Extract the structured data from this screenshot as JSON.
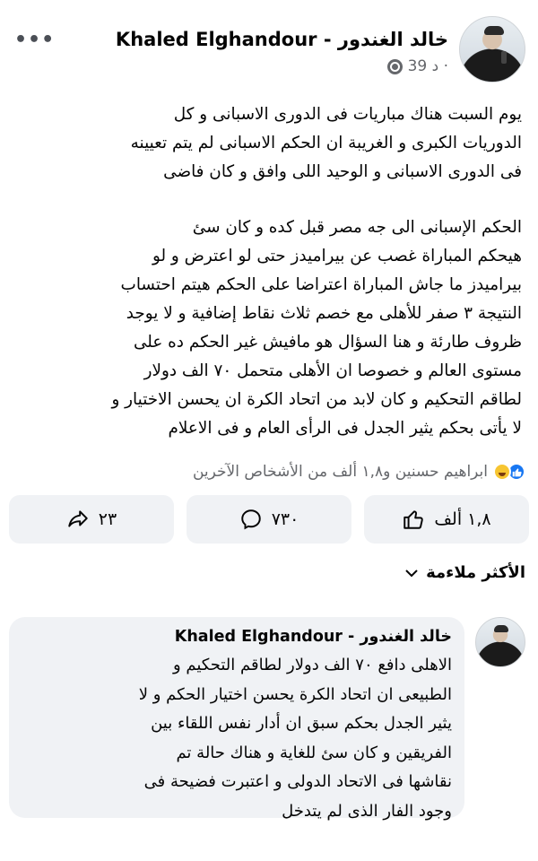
{
  "post": {
    "author": "Khaled Elghandour - خالد الغندور",
    "time": "39 د ·",
    "privacy_icon": "globe-icon",
    "more_label": "•••",
    "paragraph1": "يوم السبت هناك مباريات فى الدورى الاسبانى و كل\nالدوريات الكبرى  و الغريبة ان الحكم الاسبانى لم يتم تعيينه\nفى الدورى الاسبانى و الوحيد اللى وافق و كان فاضى",
    "paragraph2": "الحكم الإسبانى  الى جه مصر قبل كده و كان سئ\nهيحكم المباراة غصب عن بيراميدز حتى لو اعترض و لو\nبيراميدز ما جاش المباراة اعتراضا على الحكم هيتم احتساب\nالنتيجة ٣ صفر للأهلى مع خصم ثلاث نقاط إضافية و لا يوجد\nظروف طارئة  و هنا السؤال هو مافيش غير الحكم ده على\nمستوى العالم و خصوصا  ان الأهلى  متحمل ٧٠ الف دولار\nلطاقم التحكيم و كان لابد من اتحاد الكرة ان يحسن الاختيار و\nلا يأتى بحكم يثير الجدل فى الرأى العام و فى الاعلام"
  },
  "reactions": {
    "summary": "ابراهيم حسنين و١,٨ ألف من الأشخاص الآخرين",
    "icons": [
      "like-icon",
      "haha-icon"
    ]
  },
  "actions": {
    "like_label": "١,٨ ألف",
    "comment_label": "٧٣٠",
    "share_label": "٢٣"
  },
  "sort": {
    "label": "الأكثر ملاءمة"
  },
  "comment": {
    "author": "Khaled Elghandour - خالد الغندور",
    "text": "الاهلى دافع ٧٠ الف دولار لطاقم التحكيم و\nالطبيعى ان اتحاد الكرة يحسن اختيار الحكم و لا\nيثير الجدل بحكم سبق ان أدار نفس اللقاء بين\nالفريقين و كان سئ للغاية و هناك حالة تم\nنقاشها فى الاتحاد الدولى و اعتبرت فضيحة فى\nوجود الفار الذى لم يتدخل"
  },
  "colors": {
    "secondary_text": "#65676b",
    "button_bg": "#f0f2f5",
    "like_blue": "#1877f2"
  }
}
